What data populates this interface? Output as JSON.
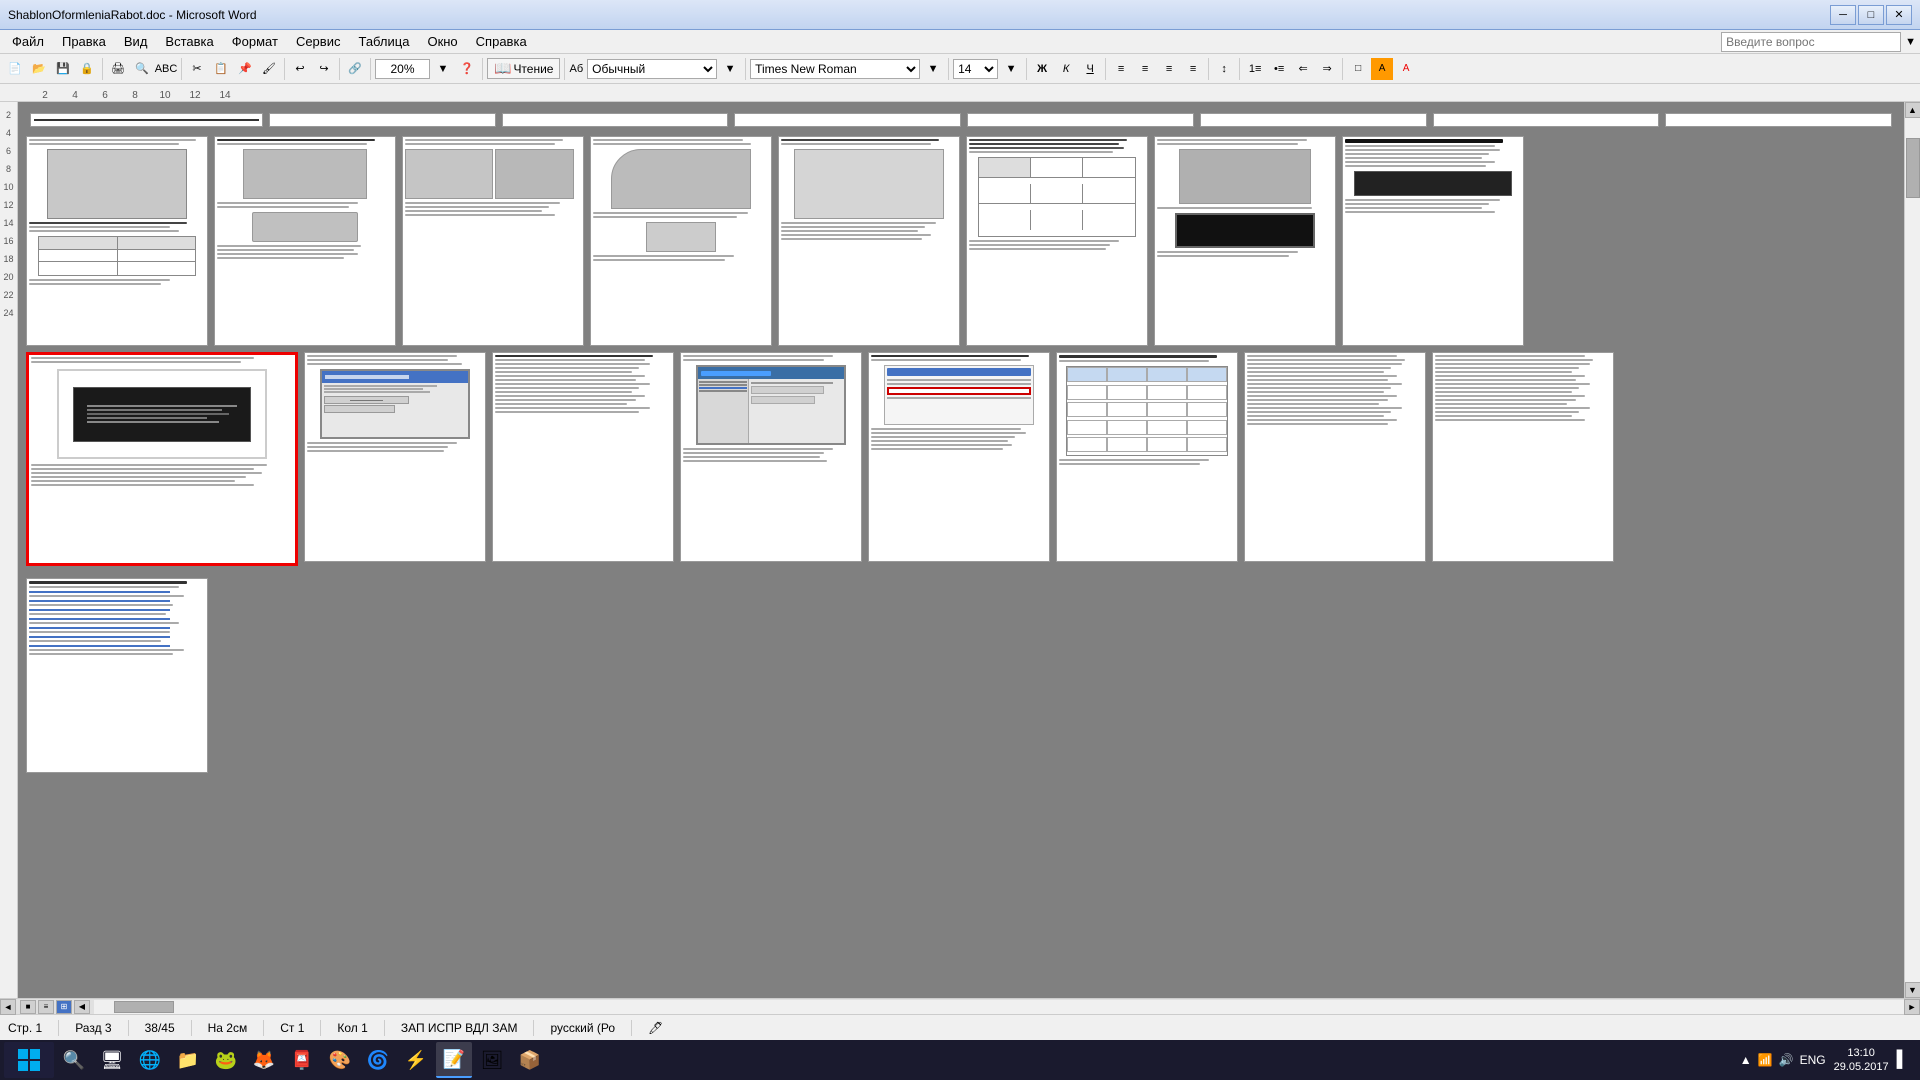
{
  "window": {
    "title": "ShablonOformleniaRabot.doc - Microsoft Word",
    "controls": [
      "_",
      "□",
      "✕"
    ]
  },
  "menu": {
    "items": [
      "Файл",
      "Правка",
      "Вид",
      "Вставка",
      "Формат",
      "Сервис",
      "Таблица",
      "Окно",
      "Справка"
    ]
  },
  "toolbar": {
    "zoom": "20%",
    "reading_label": "Чтение",
    "style": "Обычный",
    "font": "Times New Roman",
    "size": "14",
    "search_placeholder": "Введите вопрос"
  },
  "statusbar": {
    "page": "Стр. 1",
    "section": "Разд 3",
    "position": "38/45",
    "margin": "На 2см",
    "col1": "Ст 1",
    "col2": "Кол 1",
    "flags": "ЗАП  ИСПР  ВДЛ  ЗАМ",
    "lang": "русский (Ро",
    "icon": "🖊"
  },
  "taskbar": {
    "time": "13:10",
    "date": "29.05.2017",
    "lang": "ENG",
    "start_icon": "⊞",
    "apps": [
      "🔍",
      "🖥",
      "🌐",
      "📁",
      "🐸",
      "🦊",
      "📮",
      "🎨",
      "🌀",
      "⚡",
      "📝",
      "🖼",
      "📦"
    ]
  },
  "pages": {
    "selected_page": 9,
    "rows": [
      {
        "row_index": 0,
        "pages": [
          {
            "id": 1,
            "type": "mixed",
            "has_image": true,
            "selected": false
          },
          {
            "id": 2,
            "type": "mixed",
            "has_image": true,
            "selected": false
          },
          {
            "id": 3,
            "type": "mixed",
            "has_image": true,
            "selected": false
          },
          {
            "id": 4,
            "type": "mixed",
            "has_image": true,
            "selected": false
          },
          {
            "id": 5,
            "type": "mixed",
            "has_image": true,
            "selected": false
          },
          {
            "id": 6,
            "type": "mixed",
            "has_image": true,
            "selected": false
          },
          {
            "id": 7,
            "type": "mixed",
            "has_image": true,
            "selected": false
          },
          {
            "id": 8,
            "type": "mixed",
            "has_image": true,
            "selected": false
          }
        ]
      },
      {
        "row_index": 1,
        "pages": [
          {
            "id": 9,
            "type": "screen",
            "has_image": true,
            "selected": true
          },
          {
            "id": 10,
            "type": "mixed",
            "has_image": true,
            "selected": false
          },
          {
            "id": 11,
            "type": "mixed",
            "has_image": true,
            "selected": false
          },
          {
            "id": 12,
            "type": "mixed",
            "has_image": true,
            "selected": false
          },
          {
            "id": 13,
            "type": "mixed",
            "has_image": true,
            "selected": false
          },
          {
            "id": 14,
            "type": "mixed",
            "has_image": true,
            "selected": false
          },
          {
            "id": 15,
            "type": "text",
            "has_image": false,
            "selected": false
          },
          {
            "id": 16,
            "type": "text",
            "has_image": false,
            "selected": false
          }
        ]
      },
      {
        "row_index": 2,
        "pages": [
          {
            "id": 17,
            "type": "text",
            "has_image": false,
            "selected": false
          }
        ]
      }
    ]
  }
}
